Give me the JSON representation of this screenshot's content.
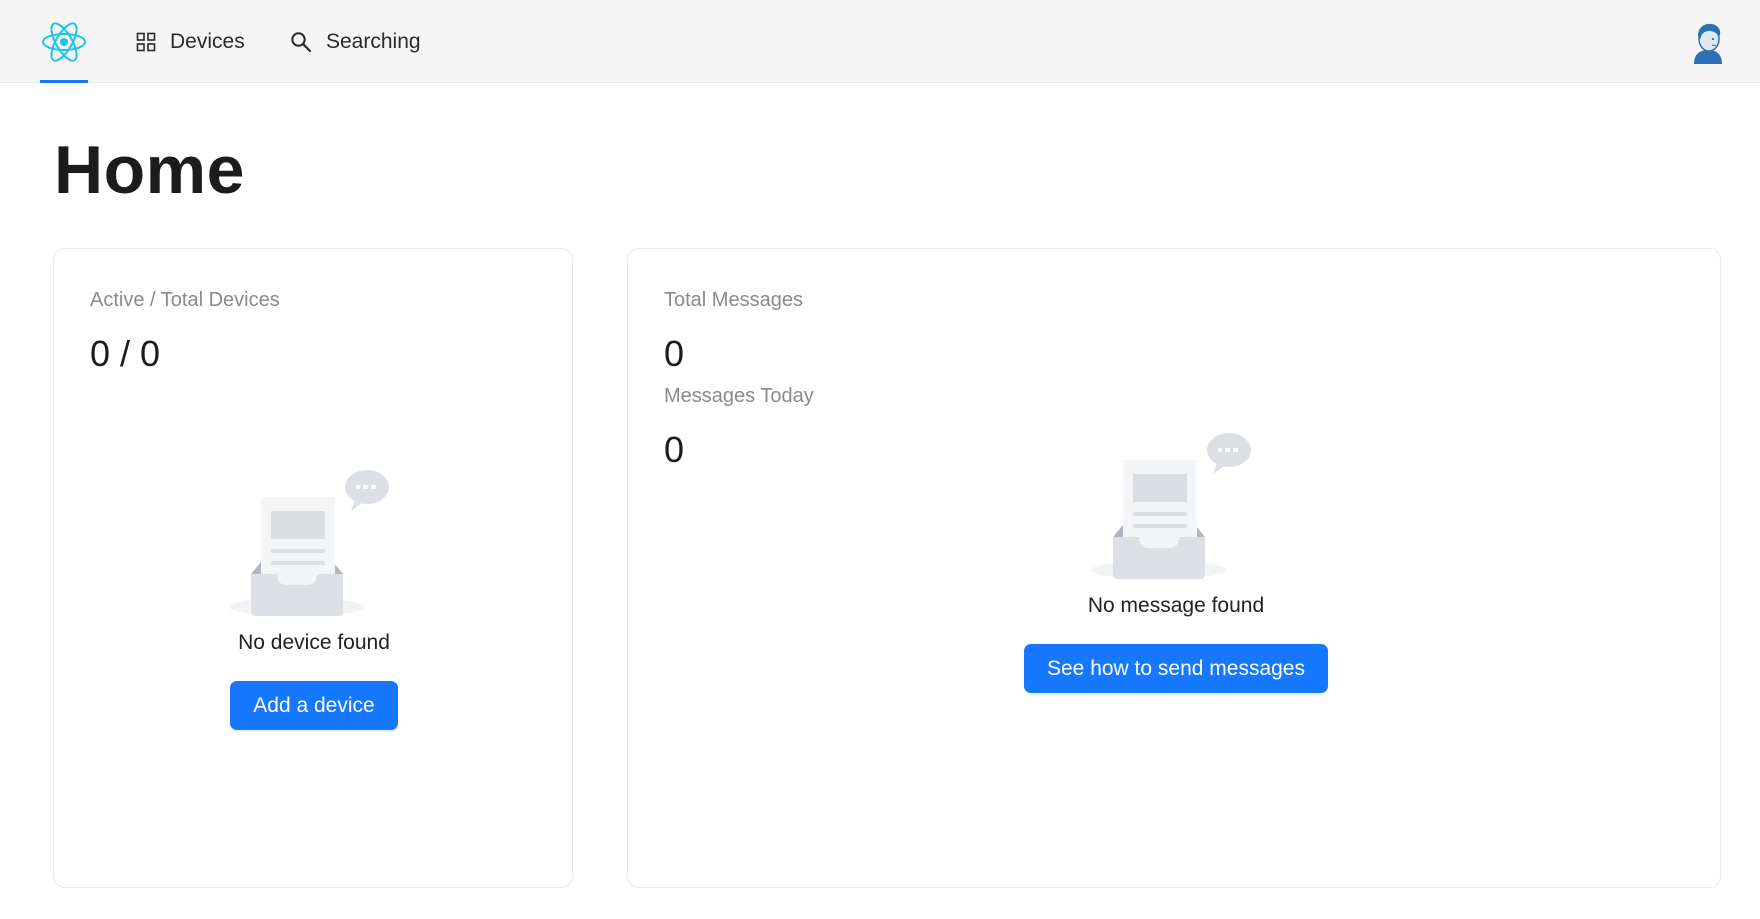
{
  "nav": {
    "logo_icon": "react-atom-icon",
    "items": [
      {
        "label": "Devices",
        "icon": "app-grid-icon"
      },
      {
        "label": "Searching",
        "icon": "search-icon"
      }
    ],
    "active_indicator_color": "#1677ff",
    "avatar_icon": "user-avatar"
  },
  "page": {
    "title": "Home"
  },
  "devices_card": {
    "label": "Active / Total Devices",
    "value": "0 / 0",
    "empty_icon": "empty-inbox-icon",
    "empty_text": "No device found",
    "button_label": "Add a device"
  },
  "messages_card": {
    "total_label": "Total Messages",
    "total_value": "0",
    "today_label": "Messages Today",
    "today_value": "0",
    "empty_icon": "empty-inbox-icon",
    "empty_text": "No message found",
    "button_label": "See how to send messages"
  },
  "colors": {
    "accent": "#1677ff",
    "topbar_bg": "#f5f5f5",
    "muted_text": "#8a8a8a"
  }
}
